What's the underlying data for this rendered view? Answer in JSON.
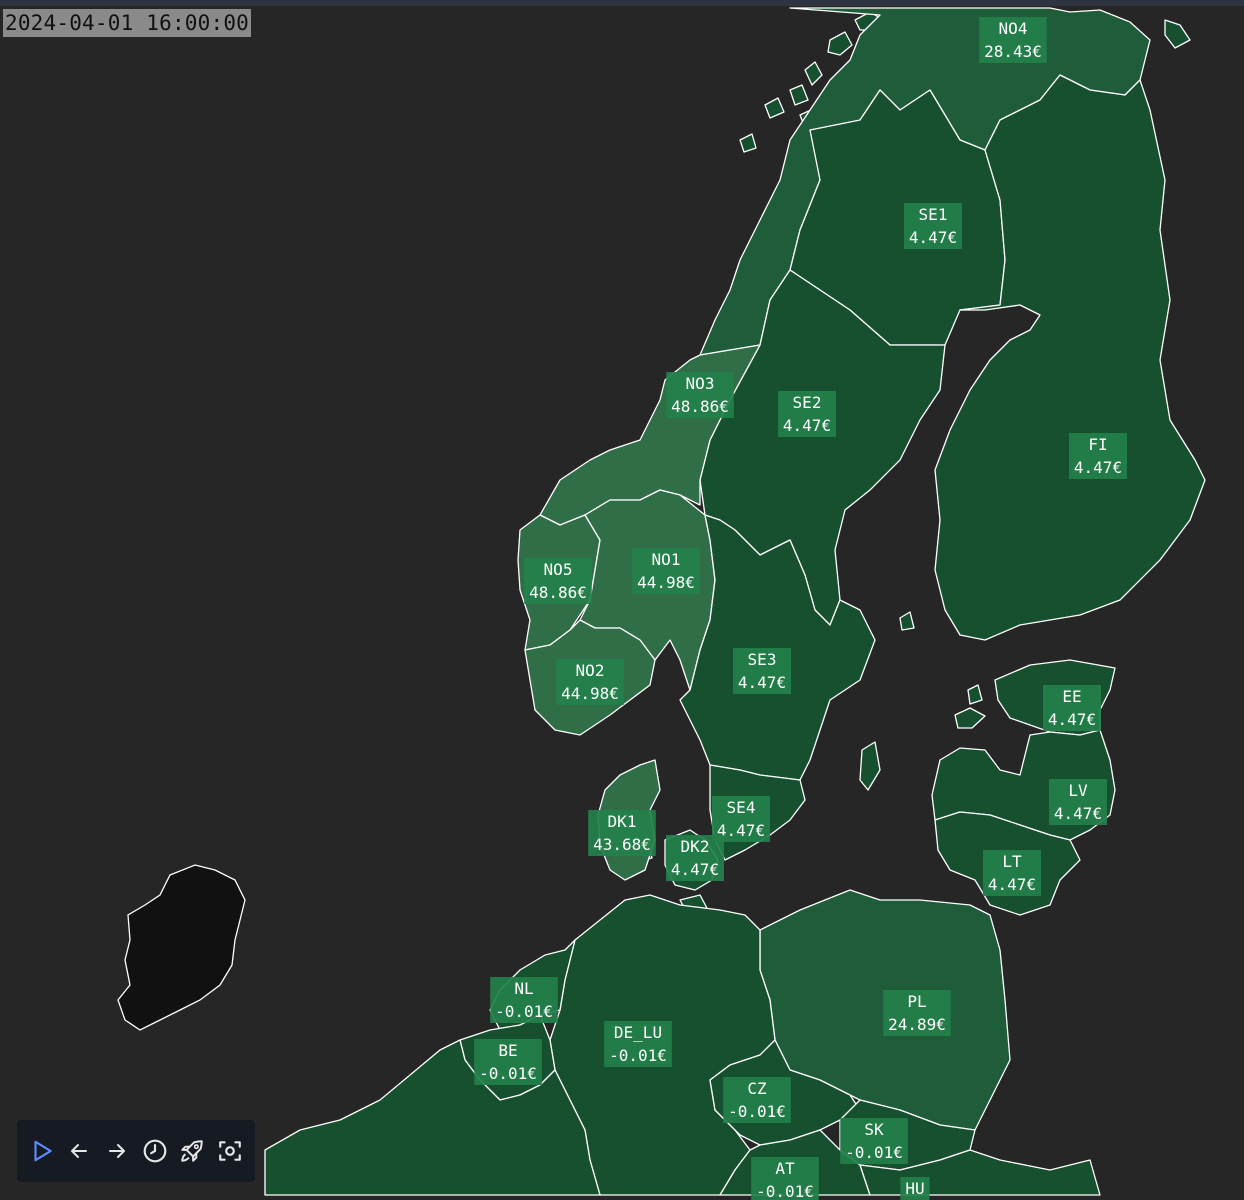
{
  "timestamp": "2024-04-01 16:00:00",
  "colors": {
    "background": "#262626",
    "low_price": "#17502f",
    "mid_price": "#1f5c3a",
    "high_price": "#2f6e47",
    "no_data": "#111111",
    "label_bg": "#24804b",
    "border": "#ffffff"
  },
  "zones": [
    {
      "code": "NO4",
      "price": "28.43€",
      "tier": "mid"
    },
    {
      "code": "SE1",
      "price": "4.47€",
      "tier": "low"
    },
    {
      "code": "NO3",
      "price": "48.86€",
      "tier": "high"
    },
    {
      "code": "SE2",
      "price": "4.47€",
      "tier": "low"
    },
    {
      "code": "FI",
      "price": "4.47€",
      "tier": "low"
    },
    {
      "code": "NO5",
      "price": "48.86€",
      "tier": "high"
    },
    {
      "code": "NO1",
      "price": "44.98€",
      "tier": "high"
    },
    {
      "code": "NO2",
      "price": "44.98€",
      "tier": "high"
    },
    {
      "code": "SE3",
      "price": "4.47€",
      "tier": "low"
    },
    {
      "code": "EE",
      "price": "4.47€",
      "tier": "low"
    },
    {
      "code": "LV",
      "price": "4.47€",
      "tier": "low"
    },
    {
      "code": "SE4",
      "price": "4.47€",
      "tier": "low"
    },
    {
      "code": "DK1",
      "price": "43.68€",
      "tier": "high"
    },
    {
      "code": "DK2",
      "price": "4.47€",
      "tier": "low"
    },
    {
      "code": "LT",
      "price": "4.47€",
      "tier": "low"
    },
    {
      "code": "NL",
      "price": "-0.01€",
      "tier": "low"
    },
    {
      "code": "PL",
      "price": "24.89€",
      "tier": "mid"
    },
    {
      "code": "DE_LU",
      "price": "-0.01€",
      "tier": "low"
    },
    {
      "code": "BE",
      "price": "-0.01€",
      "tier": "low"
    },
    {
      "code": "CZ",
      "price": "-0.01€",
      "tier": "low"
    },
    {
      "code": "SK",
      "price": "-0.01€",
      "tier": "low"
    },
    {
      "code": "AT",
      "price": "-0.01€",
      "tier": "low"
    },
    {
      "code": "HU",
      "price": "",
      "tier": "low"
    }
  ],
  "toolbar": [
    {
      "icon": "play-icon",
      "label": "Play",
      "color": "#5a8cff"
    },
    {
      "icon": "arrow-left-icon",
      "label": "Previous",
      "color": "#e6e6e6"
    },
    {
      "icon": "arrow-right-icon",
      "label": "Next",
      "color": "#e6e6e6"
    },
    {
      "icon": "clock-icon",
      "label": "Time",
      "color": "#e6e6e6"
    },
    {
      "icon": "rocket-icon",
      "label": "Launch",
      "color": "#e6e6e6"
    },
    {
      "icon": "focus-icon",
      "label": "Focus",
      "color": "#e6e6e6"
    }
  ]
}
